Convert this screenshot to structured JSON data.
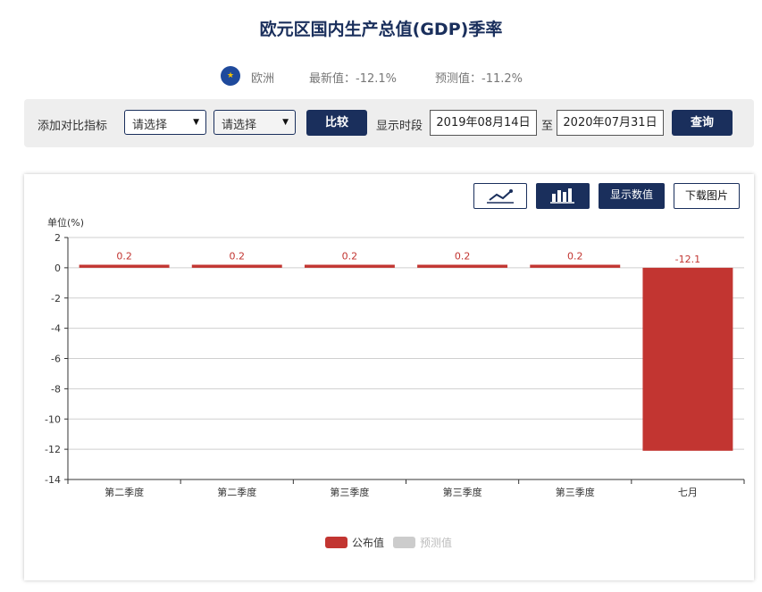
{
  "header": {
    "title": "欧元区国内生产总值(GDP)季率"
  },
  "info": {
    "flag_icon": "eu-flag-icon",
    "region": "欧洲",
    "latest": "最新值：-12.1%",
    "forecast": "预测值：-11.2%"
  },
  "toolbar": {
    "compare_label": "添加对比指标",
    "select1": "请选择",
    "select2": "请选择",
    "compare_button": "比较",
    "period_label": "显示时段",
    "start_date": "2019年08月14日",
    "to_label": "至",
    "end_date": "2020年07月31日",
    "query_button": "查询"
  },
  "chart_tools": {
    "line_icon": "line-chart-icon",
    "bar_icon": "bar-chart-icon",
    "show_values": "显示数值",
    "download": "下载图片"
  },
  "chart_data": {
    "type": "bar",
    "ylabel": "单位(%)",
    "ylim": [
      -14,
      2
    ],
    "yticks": [
      2,
      0,
      -2,
      -4,
      -6,
      -8,
      -10,
      -12,
      -14
    ],
    "categories": [
      "第二季度",
      "第二季度",
      "第三季度",
      "第三季度",
      "第三季度",
      "七月"
    ],
    "series": [
      {
        "name": "公布值",
        "values": [
          0.2,
          0.2,
          0.2,
          0.2,
          0.2,
          -12.1
        ],
        "color": "#c23531"
      },
      {
        "name": "预测值",
        "values": [],
        "color": "#cccccc"
      }
    ],
    "data_labels": [
      "0.2",
      "0.2",
      "0.2",
      "0.2",
      "0.2",
      "-12.1"
    ],
    "grid": true,
    "legend": "bottom-center"
  }
}
